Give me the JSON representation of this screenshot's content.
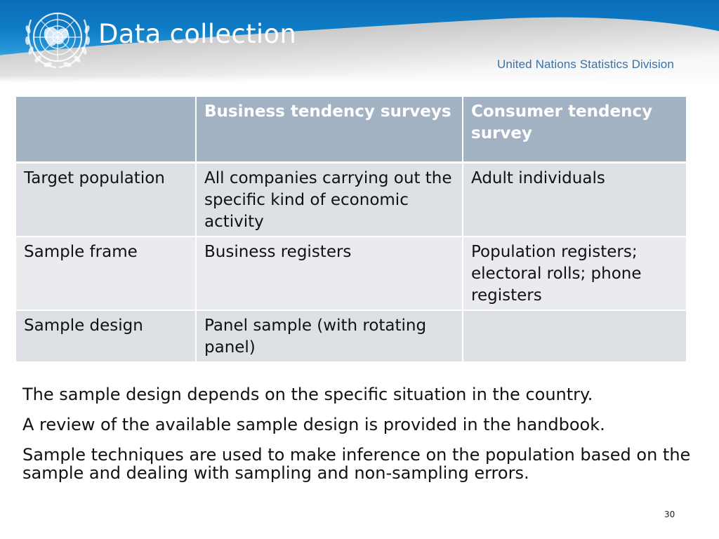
{
  "header": {
    "title": "Data collection",
    "organization": "United Nations Statistics Division",
    "logo_icon": "un-emblem-icon"
  },
  "table": {
    "columns": [
      "",
      "Business tendency surveys",
      "Consumer tendency survey"
    ],
    "rows": [
      {
        "label": "Target population",
        "business": "All companies carrying out the specific kind of economic activity",
        "consumer": "Adult individuals"
      },
      {
        "label": "Sample frame",
        "business": "Business registers",
        "consumer": "Population registers; electoral rolls; phone registers"
      },
      {
        "label": "Sample design",
        "business": "Panel sample (with rotating panel)",
        "consumer": ""
      }
    ]
  },
  "body": {
    "paragraphs": [
      "The sample design depends on the specific situation in the country.",
      "A review of the available sample design is provided in the handbook.",
      "Sample techniques are used to make inference on the population based on the sample and dealing with sampling and non-sampling errors."
    ]
  },
  "footer": {
    "page_number": "30"
  },
  "colors": {
    "header_blue": "#0f7dc6",
    "table_header": "#a2b2c2",
    "table_row": "#dde0e5",
    "division_text": "#3d6fa6"
  }
}
